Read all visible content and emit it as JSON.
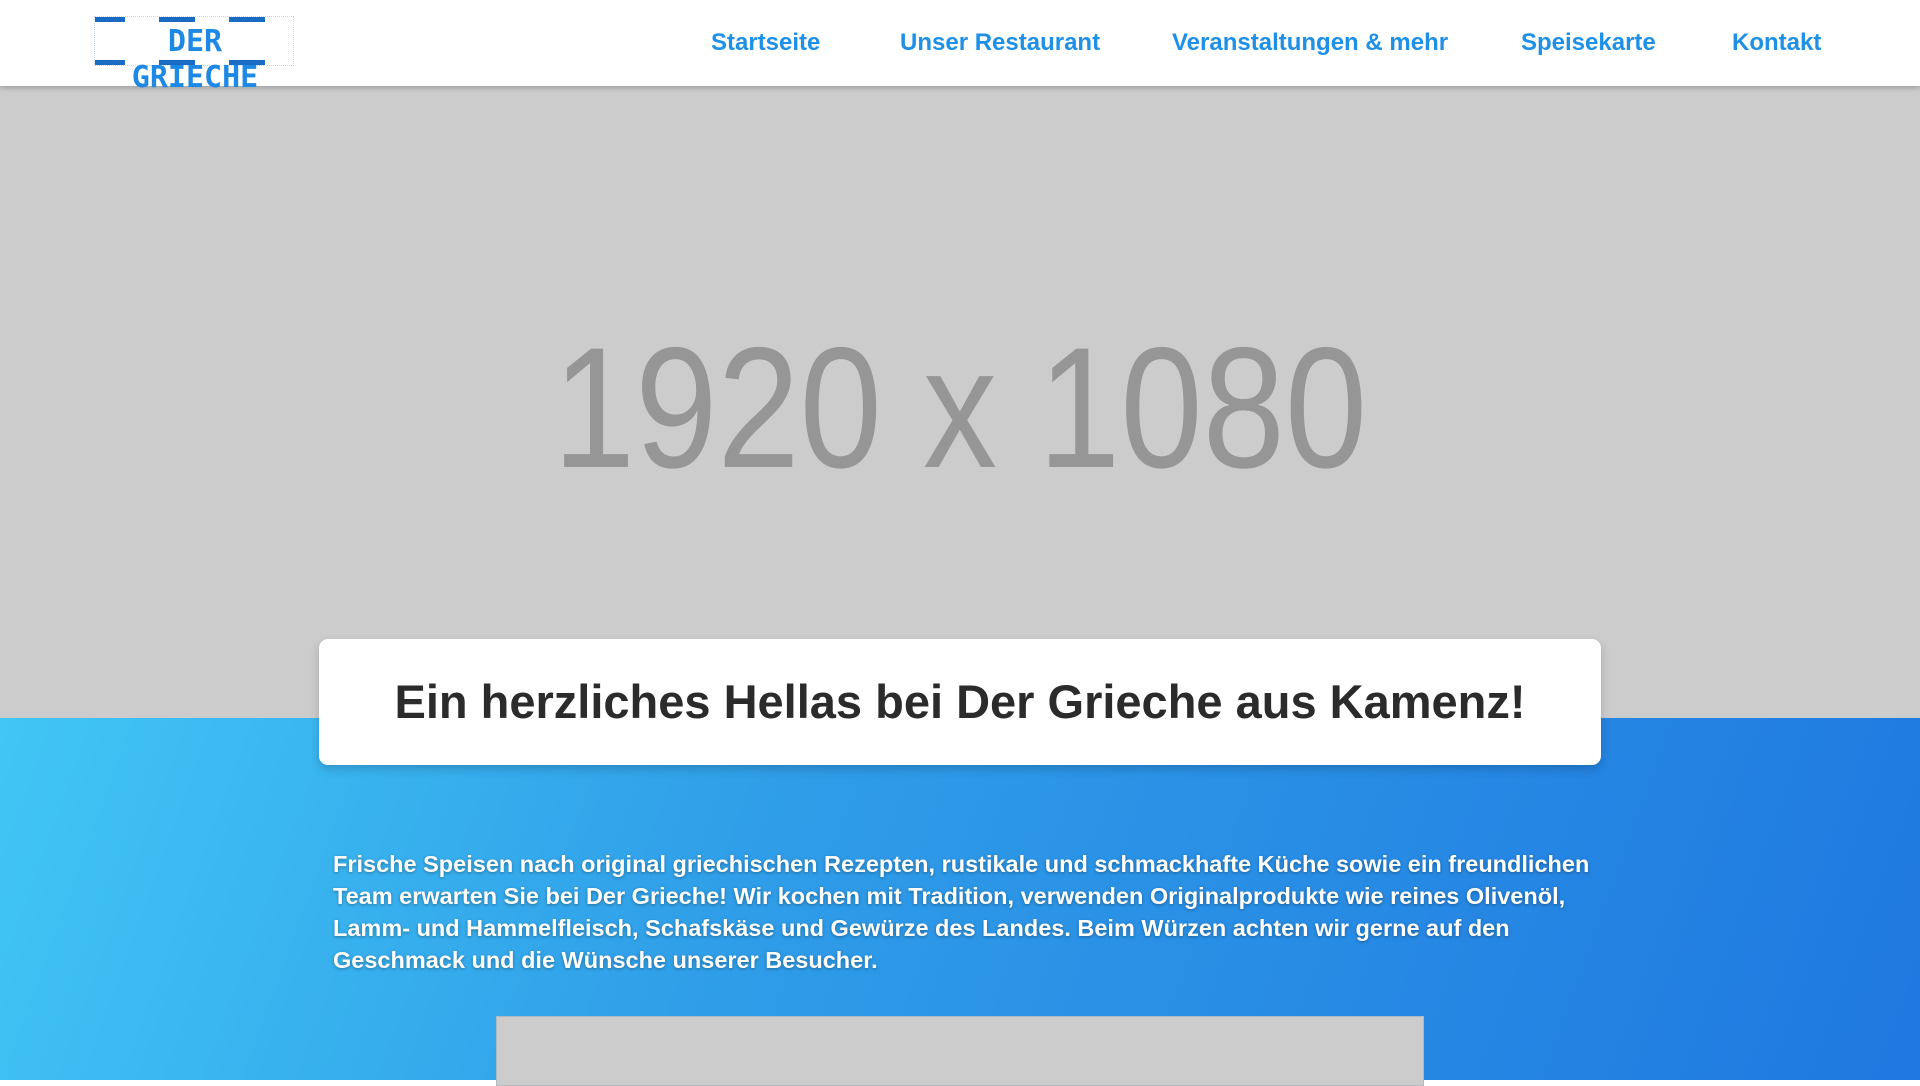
{
  "header": {
    "logo_text": "DER GRIECHE",
    "nav": [
      {
        "label": "Startseite"
      },
      {
        "label": "Unser Restaurant"
      },
      {
        "label": "Veranstaltungen & mehr"
      },
      {
        "label": "Speisekarte"
      },
      {
        "label": "Kontakt"
      }
    ]
  },
  "hero": {
    "placeholder_text": "1920 x 1080"
  },
  "main": {
    "title": "Ein herzliches Hellas bei Der Grieche aus Kamenz!",
    "intro": "Frische Speisen nach original griechischen Rezepten, rustikale und schmackhafte Küche sowie ein freundlichen Team erwarten Sie bei Der Grieche! Wir kochen mit Tradition, verwenden Originalprodukte wie reines Olivenöl, Lamm- und Hammelfleisch, Schafskäse und Gewürze des Landes. Beim Würzen achten wir gerne auf den Geschmack und die Wünsche unserer Besucher."
  },
  "colors": {
    "nav_link": "#1e90e8",
    "logo_blue": "#1a6bc4",
    "gradient_start": "#41c6f5",
    "gradient_end": "#1f78e0",
    "placeholder_gray": "#cccccc"
  }
}
